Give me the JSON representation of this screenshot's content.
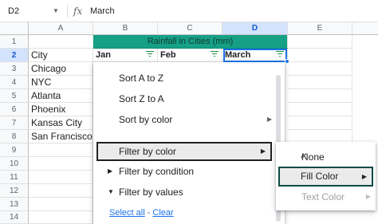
{
  "formula_bar": {
    "cell_ref": "D2",
    "fx": "fx",
    "value": "March"
  },
  "columns": [
    "A",
    "B",
    "C",
    "D",
    "E"
  ],
  "selected_column": "D",
  "rows": [
    "1",
    "2",
    "3",
    "4",
    "5",
    "6",
    "7",
    "8",
    "9",
    "10",
    "11",
    "12",
    "13",
    "14"
  ],
  "selected_row": "2",
  "sheet": {
    "title": "Rainfall in Cities (mm)",
    "headers": [
      "City",
      "Jan",
      "Feb",
      "March"
    ],
    "cities": [
      "Chicago",
      "NYC",
      "Atlanta",
      "Phoenix",
      "Kansas City",
      "San Francisco"
    ]
  },
  "filter_menu": {
    "sort_a_z": "Sort A to Z",
    "sort_z_a": "Sort Z to A",
    "sort_by_color": "Sort by color",
    "filter_by_color": "Filter by color",
    "filter_by_condition": "Filter by condition",
    "filter_by_values": "Filter by values",
    "select_all": "Select all",
    "link_sep": " - ",
    "clear": "Clear"
  },
  "color_submenu": {
    "none": "None",
    "fill_color": "Fill Color",
    "text_color": "Text Color"
  },
  "colors": {
    "header_fill": "#16a085",
    "accent": "#1a73e8",
    "selection_header": "#d3e3fd"
  }
}
